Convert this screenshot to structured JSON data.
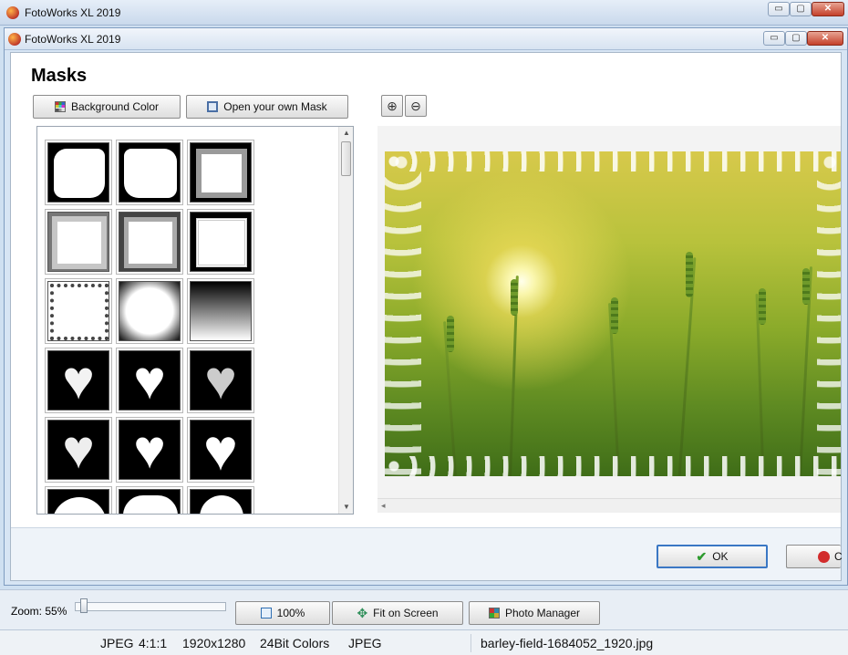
{
  "outer_window": {
    "title": "FotoWorks XL 2019",
    "buttons": {
      "minimize": "▭",
      "maximize": "▢",
      "close": "✕"
    }
  },
  "dialog": {
    "title": "FotoWorks XL 2019",
    "buttons": {
      "minimize": "▭",
      "maximize": "▢",
      "close": "✕"
    },
    "heading": "Masks",
    "background_color_button": "Background Color",
    "open_mask_button": "Open your own Mask",
    "ok_button": "OK",
    "cancel_button_partial": "C"
  },
  "mask_list": {
    "tiles": [
      {
        "name": "mask-rough-square-1"
      },
      {
        "name": "mask-rough-square-2"
      },
      {
        "name": "mask-bevel-frame-1"
      },
      {
        "name": "mask-bevel-frame-2"
      },
      {
        "name": "mask-bevel-frame-3"
      },
      {
        "name": "mask-bevel-frame-4"
      },
      {
        "name": "mask-floral-border"
      },
      {
        "name": "mask-cloud-border"
      },
      {
        "name": "mask-gradient-fade"
      },
      {
        "name": "mask-heart-pattern-1"
      },
      {
        "name": "mask-heart-plain-1"
      },
      {
        "name": "mask-heart-pattern-2"
      },
      {
        "name": "mask-heart-soft"
      },
      {
        "name": "mask-heart-plain-2"
      },
      {
        "name": "mask-heart-plain-3"
      },
      {
        "name": "mask-partial-1"
      },
      {
        "name": "mask-partial-2"
      },
      {
        "name": "mask-partial-3"
      }
    ]
  },
  "toolbar": {
    "zoom_label": "Zoom: 55%",
    "zoom_value": 55,
    "btn_100": "100%",
    "btn_fit": "Fit on Screen",
    "btn_photo_manager": "Photo Manager"
  },
  "status": {
    "format": "JPEG",
    "subsampling": "4:1:1",
    "dimensions": "1920x1280",
    "colors": "24Bit Colors",
    "type": "JPEG",
    "filename": "barley-field-1684052_1920.jpg"
  },
  "colors": {
    "ok_icon": "#2e9b2e",
    "cancel_icon": "#d22b2b",
    "accent": "#3a77c4"
  }
}
